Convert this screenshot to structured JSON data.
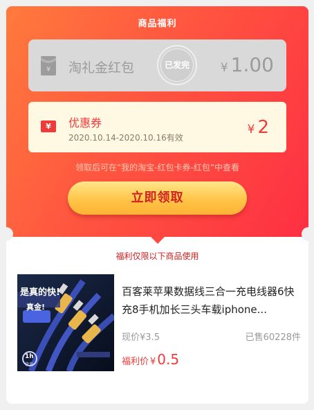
{
  "header": {
    "title": "商品福利"
  },
  "red_packet": {
    "name": "淘礼金红包",
    "stamp": "已发完",
    "currency": "¥",
    "amount": "1.00"
  },
  "coupon": {
    "name": "优惠券",
    "validity": "2020.10.14-2020.10.16有效",
    "currency": "¥",
    "amount": "2",
    "icon_glyph": "¥"
  },
  "hint": "领取后可在“我的淘宝-红包卡券-红包”中查看",
  "claim_button": {
    "label": "立即领取"
  },
  "limit_note": "福利仅限以下商品使用",
  "product": {
    "name": "百客莱苹果数据线三合一充电线器6快充8手机加长三头车载iphone...",
    "current_price_label": "现价",
    "current_price_currency": "¥",
    "current_price": "3.5",
    "sold": "已售60228件",
    "benefit_price_label": "福利价",
    "benefit_price_currency": "¥",
    "benefit_price": "0.5",
    "thumb_text": {
      "headline": "是真的快!",
      "badge": "真金!",
      "time_badge": "1h",
      "time_badge_sub": "快充"
    }
  },
  "colors": {
    "gradient_start": "#ff7a3c",
    "gradient_end": "#fe2f42",
    "accent_red": "#f23a3a",
    "button_yellow": "#ffc548",
    "coupon_bg": "#fff9e3",
    "disabled_gray": "#d9d9d9"
  },
  "icons": {
    "red_packet": "red-envelope-icon",
    "coupon": "coupon-ticket-icon"
  }
}
